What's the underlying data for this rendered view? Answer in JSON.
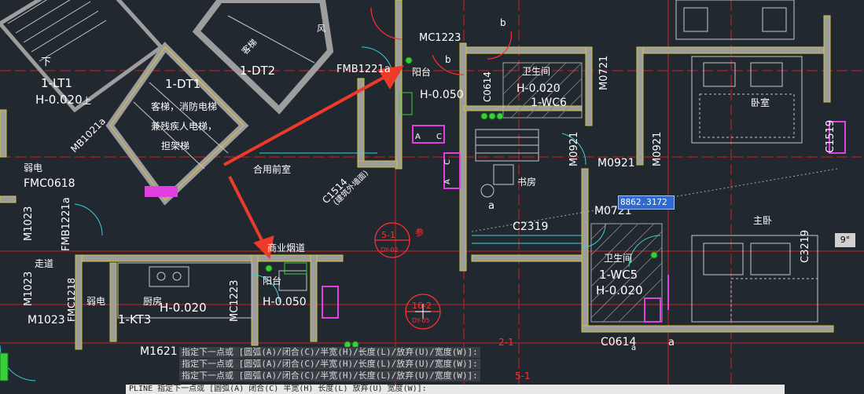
{
  "colors": {
    "background": "#212830",
    "wall_fill": "#9d9d9d",
    "wall_edge": "#d4c53a",
    "axis": "#d21f1f",
    "door": "#3ed0d8",
    "arrow": "#ee3a2a",
    "hatch": "#c8c8c8",
    "magenta": "#e040e0",
    "green": "#38d038"
  },
  "labels": {
    "mc1223_top": "MC1223",
    "fmb1221a_top": "FMB1221a",
    "yangtai_top": "阳台",
    "b_top": "b",
    "b_mid": "b",
    "weishengjian_top": "卫生间",
    "h0020_wc6": "H-0.020",
    "wc6": "1-WC6",
    "c0614_left": "C0614",
    "m0721_top": "M0721",
    "woshi": "卧室",
    "c1519": "C1519",
    "m0921_left": "M0921",
    "m0921_mid": "M0921",
    "m0921_right": "M0921",
    "h0050_top": "H-0.050",
    "a_top": "A",
    "c_top": "C",
    "a_mid": "A",
    "c_mid": "C",
    "dt2_title": "客梯",
    "dt2": "1-DT2",
    "dt1": "1-DT1",
    "dt1_desc1": "客梯，消防电梯",
    "dt1_desc2": "兼残疾人电梯，",
    "dt1_desc3": "担架梯",
    "lt1_down": "下",
    "lt1": "1-LT1",
    "lt1_h": "H-0.020",
    "lt1_up": "上",
    "mb1021a": "MB1021a",
    "ruodian_left": "弱电",
    "fmc0618": "FMC0618",
    "m1023_left": "M1023",
    "fmb1221a_left": "FMB1221a",
    "zoudao": "走道",
    "heyongqianshi": "合用前室",
    "c1514": "C1514",
    "jiaohuwai_desc": "(建筑外墙面)",
    "shufang": "书房",
    "c2319": "C2319",
    "m0721_mid": "M0721",
    "dyn_value": "8862.3172",
    "zhuwo": "主卧",
    "c3219": "C3219",
    "angle": "9°",
    "axis_5_1": "5-1",
    "axis_dy02": "DY-02",
    "axis_16_2": "16-2",
    "axis_dy05": "DY-05",
    "axis_2_1": "2-1",
    "axis_5_1b": "5-1",
    "shangye_yandao": "商业烟道",
    "yangtai_bottom": "阳台",
    "h0050_bottom": "H-0.050",
    "mc1223_bottom": "MC1223",
    "chufang": "厨房",
    "h0020_kt": "H-0.020",
    "kt3": "1-KT3",
    "ruodian_bottom": "弱电",
    "fmc1218": "FMC1218",
    "m1023_bottom": "M1023",
    "m1023_bottom2": "M1023",
    "m1621": "M1621",
    "weishengjian_wc5": "卫生间",
    "wc5": "1-WC5",
    "h0020_wc5": "H-0.020",
    "c0614_bottom": "C0614",
    "a_wc5": "a",
    "a_bottom": "a",
    "a_shufang": "a",
    "feng": "风",
    "can": "参",
    "cmd_hist_1": "指定下一点或 [圆弧(A)/闭合(C)/半宽(H)/长度(L)/放弃(U)/宽度(W)]:",
    "cmd_hist_2": "指定下一点或 [圆弧(A)/闭合(C)/半宽(H)/长度(L)/放弃(U)/宽度(W)]:",
    "cmd_hist_3": "指定下一点或 [圆弧(A)/闭合(C)/半宽(H)/长度(L)/放弃(U)/宽度(W)]:",
    "cmd_input": "PLINE 指定下一点或 [圆弧(A) 闭合(C) 半宽(H) 长度(L) 放弃(U) 宽度(W)]:"
  }
}
